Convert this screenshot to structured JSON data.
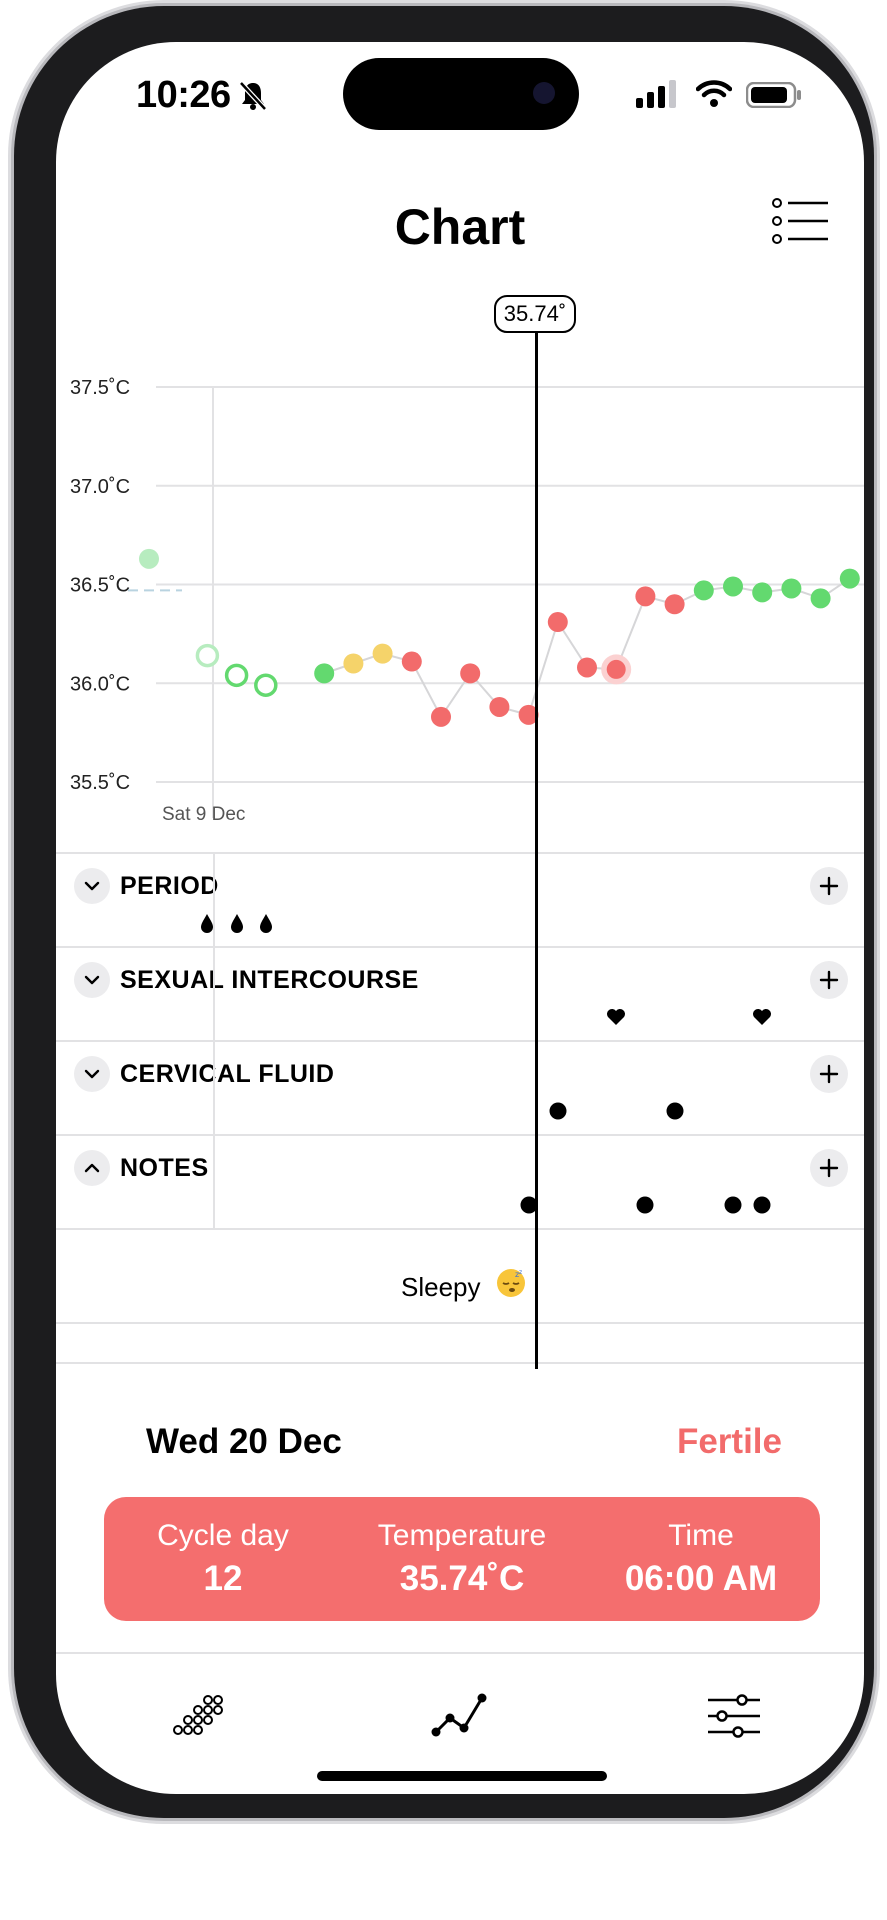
{
  "status_bar": {
    "time": "10:26"
  },
  "header": {
    "title": "Chart"
  },
  "chart_data": {
    "type": "scatter",
    "y_ticks": [
      "37.5˚C",
      "37.0˚C",
      "36.5˚C",
      "36.0˚C",
      "35.5˚C"
    ],
    "y_values": [
      37.5,
      37.0,
      36.5,
      36.0,
      35.5
    ],
    "ylim": [
      35.5,
      37.5
    ],
    "x_label_date": "Sat 9 Dec",
    "selected_value_label": "35.74˚",
    "colors": {
      "green": "#63d96f",
      "yellow": "#f5d36a",
      "red": "#f26b6b",
      "light_green": "#b7ecbf",
      "line": "#d6d6d8"
    },
    "points": [
      {
        "day": 0,
        "temp": 36.63,
        "color": "light_green",
        "style": "filled"
      },
      {
        "day": 2,
        "temp": 36.14,
        "color": "light_green",
        "style": "open"
      },
      {
        "day": 3,
        "temp": 36.04,
        "color": "green",
        "style": "open"
      },
      {
        "day": 4,
        "temp": 35.99,
        "color": "green",
        "style": "open"
      },
      {
        "day": 6,
        "temp": 36.05,
        "color": "green",
        "style": "filled"
      },
      {
        "day": 7,
        "temp": 36.1,
        "color": "yellow",
        "style": "filled"
      },
      {
        "day": 8,
        "temp": 36.15,
        "color": "yellow",
        "style": "filled"
      },
      {
        "day": 9,
        "temp": 36.11,
        "color": "red",
        "style": "filled"
      },
      {
        "day": 10,
        "temp": 35.83,
        "color": "red",
        "style": "filled"
      },
      {
        "day": 11,
        "temp": 36.05,
        "color": "red",
        "style": "filled"
      },
      {
        "day": 12,
        "temp": 35.88,
        "color": "red",
        "style": "filled"
      },
      {
        "day": 13,
        "temp": 35.84,
        "color": "red",
        "style": "filled"
      },
      {
        "day": 14,
        "temp": 36.31,
        "color": "red",
        "style": "filled"
      },
      {
        "day": 15,
        "temp": 36.08,
        "color": "red",
        "style": "filled"
      },
      {
        "day": 16,
        "temp": 36.07,
        "color": "red",
        "style": "halo"
      },
      {
        "day": 17,
        "temp": 36.44,
        "color": "red",
        "style": "filled"
      },
      {
        "day": 18,
        "temp": 36.4,
        "color": "red",
        "style": "filled"
      },
      {
        "day": 19,
        "temp": 36.47,
        "color": "green",
        "style": "filled"
      },
      {
        "day": 20,
        "temp": 36.49,
        "color": "green",
        "style": "filled"
      },
      {
        "day": 21,
        "temp": 36.46,
        "color": "green",
        "style": "filled"
      },
      {
        "day": 22,
        "temp": 36.48,
        "color": "green",
        "style": "filled"
      },
      {
        "day": 23,
        "temp": 36.43,
        "color": "green",
        "style": "filled"
      },
      {
        "day": 24,
        "temp": 36.53,
        "color": "green",
        "style": "filled"
      }
    ],
    "selected_day": 13
  },
  "rows": [
    {
      "label": "PERIOD",
      "expanded": false,
      "marker": "drop",
      "days": [
        2,
        3,
        4
      ]
    },
    {
      "label": "SEXUAL INTERCOURSE",
      "expanded": false,
      "marker": "heart",
      "days": [
        16,
        21
      ]
    },
    {
      "label": "CERVICAL FLUID",
      "expanded": false,
      "marker": "dot",
      "days": [
        14,
        18
      ]
    },
    {
      "label": "NOTES",
      "expanded": true,
      "marker": "dot",
      "days": [
        13,
        17,
        20,
        21
      ]
    }
  ],
  "note": {
    "text": "Sleepy"
  },
  "detail": {
    "date": "Wed 20 Dec",
    "status": "Fertile",
    "cells": [
      {
        "label": "Cycle day",
        "value": "12"
      },
      {
        "label": "Temperature",
        "value": "35.74˚C"
      },
      {
        "label": "Time",
        "value": "06:00 AM"
      }
    ]
  },
  "tabs": [
    {
      "name": "cycle-tab",
      "icon": "dots-grid-icon"
    },
    {
      "name": "chart-tab",
      "icon": "chart-line-icon"
    },
    {
      "name": "settings-tab",
      "icon": "sliders-icon"
    }
  ]
}
